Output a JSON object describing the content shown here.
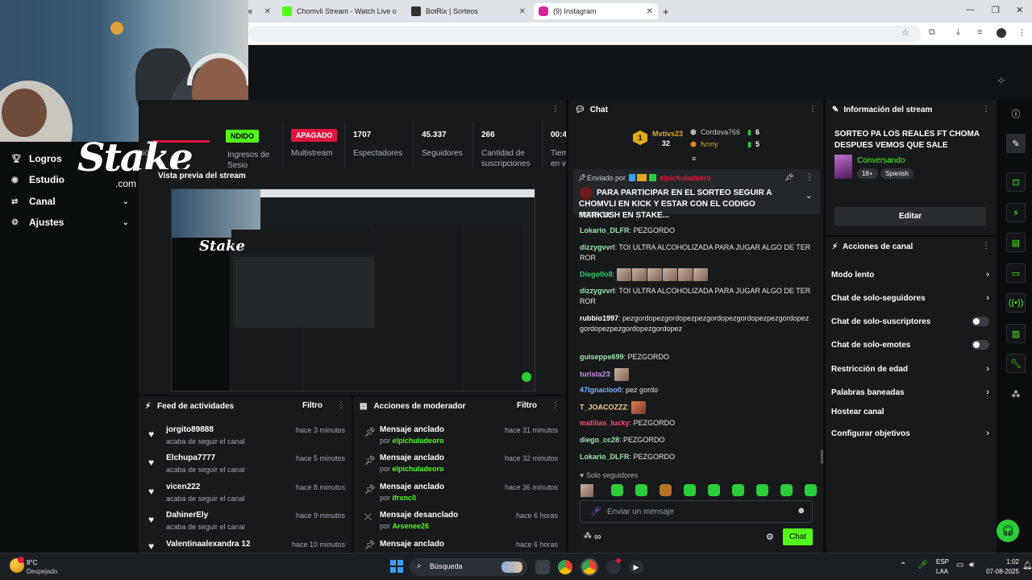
{
  "browser": {
    "tabs": [
      {
        "label": "Chomvli Stream - Watch Live o",
        "color": "#53fc18"
      },
      {
        "label": "BotRix | Sorteos",
        "color": "#333333"
      },
      {
        "label": "(9) Instagram",
        "color": "#d6249f"
      }
    ],
    "partial_tab_label": "e"
  },
  "left_menu": {
    "items": [
      {
        "label": "Logros",
        "icon": "trophy-icon"
      },
      {
        "label": "Estudio",
        "icon": "record-icon"
      },
      {
        "label": "Canal",
        "icon": "channel-icon",
        "chevron": true
      },
      {
        "label": "Ajustes",
        "icon": "gear-icon",
        "chevron": true
      }
    ]
  },
  "logo": {
    "text": "Stake",
    "subtext": ".com"
  },
  "stats_panel": {
    "status_live": "NDIDO",
    "multistream_badge": "APAGADO",
    "cut_label_1": "sión",
    "cut_label_2": "Ingresos de Sesio",
    "multistream_label": "Multistream",
    "stats": [
      {
        "value": "1707",
        "label": "Espectadores"
      },
      {
        "value": "45.337",
        "label": "Seguidores"
      },
      {
        "value": "266",
        "label": "Cantidad de suscripciones"
      },
      {
        "value": "00:4",
        "label": "Tiem en vi"
      }
    ]
  },
  "preview": {
    "title": "Vista previa del stream"
  },
  "feed": {
    "title": "Feed de actividades",
    "filter": "Filtro",
    "items": [
      {
        "name": "jorgito89888",
        "action": "acaba de seguir el canal",
        "time": "hace 3 minutos"
      },
      {
        "name": "Elchupa7777",
        "action": "acaba de seguir el canal",
        "time": "hace 5 minutos"
      },
      {
        "name": "vicen222",
        "action": "acaba de seguir el canal",
        "time": "hace 8 minutos"
      },
      {
        "name": "DahinerEly",
        "action": "acaba de seguir el canal",
        "time": "hace 9 minutos"
      },
      {
        "name": "Valentinaalexandra 12",
        "action": "",
        "time": "hace 10 minutos"
      }
    ]
  },
  "mod_actions": {
    "title": "Acciones de moderador",
    "filter": "Filtro",
    "by_prefix": "por",
    "items": [
      {
        "title": "Mensaje anclado",
        "by": "elpichuladeoro",
        "time": "hace 31 minutos",
        "icon": "pin-icon"
      },
      {
        "title": "Mensaje anclado",
        "by": "elpichuladeoro",
        "time": "hace 32 minutos",
        "icon": "pin-icon"
      },
      {
        "title": "Mensaje anclado",
        "by": "ifrxnc0",
        "time": "hace 36 minutos",
        "icon": "pin-icon"
      },
      {
        "title": "Mensaje desanclado",
        "by": "Arsenee26",
        "time": "hace 6 horas",
        "icon": "unpin-icon"
      },
      {
        "title": "Mensaje anclado",
        "by": "",
        "time": "hace 6 horas",
        "icon": "pin-icon"
      }
    ]
  },
  "chat": {
    "title": "Chat",
    "top_gifters": [
      {
        "rank": "1",
        "name": "Mvtivs23",
        "count": "32"
      },
      {
        "name": "Cordova766",
        "count": "6"
      },
      {
        "name": "fvnny",
        "count": "5"
      }
    ],
    "pinned": {
      "sent_by_label": "Enviado por",
      "sender": "elpichuladeoro",
      "text": "PARA PARTICIPAR EN EL SORTEO SEGUIR A CHOMVLI EN KICK Y ESTAR CON EL CODIGO MARKUSH EN STAKE..."
    },
    "cut_top": "TERROR",
    "messages": [
      {
        "user": "Lokario_DLFR",
        "color": "#9ee6b0",
        "text": "PEZGORDO"
      },
      {
        "user": "dizzygvvrl",
        "color": "#9ee6b0",
        "text": "TOI ULTRA ALCOHOLIZADA PARA JUGAR ALGO DE TERROR"
      },
      {
        "user": "Diego0o8",
        "color": "#2ecc71",
        "text": "",
        "emotes": 6
      },
      {
        "user": "dizzygvvrl",
        "color": "#9ee6b0",
        "text": "TOI ULTRA ALCOHOLIZADA PARA JUGAR ALGO DE TERROR"
      },
      {
        "user": "rubbio1997",
        "color": "#ffffff",
        "text": "pezgordopezgordopezpezgordopezgordopezpezgordopezgordopezpezgordopezgordopez"
      },
      {
        "user": "guiseppe699",
        "color": "#9ee6b0",
        "text": "PEZGORDO"
      },
      {
        "user": "turista23",
        "color": "#c792ea",
        "text": "",
        "emotes": 1
      },
      {
        "user": "47Ignacioo0",
        "color": "#7fb3ff",
        "text": "pez gordo"
      },
      {
        "user": "T_JOACOZZZ",
        "color": "#ffd08a",
        "text": "",
        "emotes": 1
      },
      {
        "user": "matilias_lucky",
        "color": "#ff4d6d",
        "text": "PEZGORDO"
      },
      {
        "user": "diego_cc28",
        "color": "#9ee6b0",
        "text": "PEZGORDO"
      },
      {
        "user": "Lokario_DLFR",
        "color": "#9ee6b0",
        "text": "PEZGORDO"
      }
    ],
    "followers_only_label": "Solo seguidores",
    "input_placeholder": "Enviar un mensaje",
    "send_label": "Chat"
  },
  "stream_info": {
    "title": "Información del stream",
    "stream_title": "SORTEO PA LOS REALES FT CHOMA DESPUES VEMOS QUE SALE",
    "category": "Conversando",
    "tags": [
      "18+",
      "Spanish"
    ],
    "edit_label": "Editar"
  },
  "channel_actions": {
    "title": "Acciones de canal",
    "items": [
      {
        "label": "Modo lento",
        "type": "chevron"
      },
      {
        "label": "Chat de solo-seguidores",
        "type": "chevron"
      },
      {
        "label": "Chat de solo-suscriptores",
        "type": "toggle"
      },
      {
        "label": "Chat de solo-emotes",
        "type": "toggle"
      },
      {
        "label": "Restricción de edad",
        "type": "chevron"
      },
      {
        "label": "Palabras baneadas",
        "type": "chevron"
      },
      {
        "label": "Hostear canal",
        "type": "none"
      },
      {
        "label": "Configurar objetivos",
        "type": "chevron"
      }
    ]
  },
  "taskbar": {
    "weather_temp": "8°C",
    "weather_desc": "Despejado",
    "search_label": "Búsqueda",
    "lang": "ESP",
    "lang_sub": "LAA",
    "time": "1:02",
    "date": "07-08-2025"
  },
  "colors": {
    "accent": "#53fc18",
    "danger": "#e0133f",
    "panel": "#17191b"
  }
}
